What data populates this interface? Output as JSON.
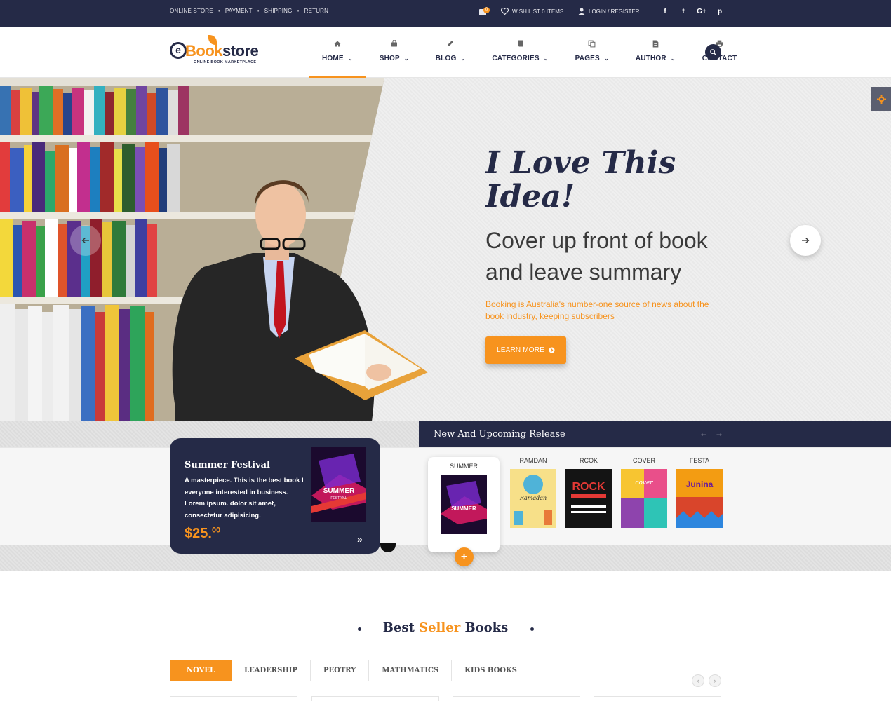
{
  "topbar": {
    "links": [
      "ONLINE STORE",
      "PAYMENT",
      "SHIPPING",
      "RETURN"
    ],
    "cart_count": "0",
    "wishlist": "WISH LIST 0 ITEMS",
    "login": "LOGIN / REGISTER",
    "social": [
      {
        "icon": "facebook-icon",
        "glyph": "f"
      },
      {
        "icon": "twitter-icon",
        "glyph": "t"
      },
      {
        "icon": "google-plus-icon",
        "glyph": "G+"
      },
      {
        "icon": "pinterest-icon",
        "glyph": "p"
      }
    ]
  },
  "logo": {
    "e": "e",
    "book": "Book",
    "store": "store",
    "tagline": "ONLINE BOOK MARKETPLACE"
  },
  "nav": [
    {
      "label": "HOME",
      "icon": "home-icon",
      "dropdown": true,
      "active": true
    },
    {
      "label": "SHOP",
      "icon": "shopping-bag-icon",
      "dropdown": true
    },
    {
      "label": "BLOG",
      "icon": "pencil-icon",
      "dropdown": true
    },
    {
      "label": "CATEGORIES",
      "icon": "book-icon",
      "dropdown": true
    },
    {
      "label": "PAGES",
      "icon": "copy-icon",
      "dropdown": true
    },
    {
      "label": "AUTHOR",
      "icon": "document-icon",
      "dropdown": true
    },
    {
      "label": "CONTACT",
      "icon": "printer-icon",
      "dropdown": false
    }
  ],
  "hero": {
    "title": "I Love This Idea!",
    "subtitle": "Cover up front of book and leave summary",
    "text": "Booking is Australia's number-one source of news about the book industry, keeping subscribers",
    "button": "LEARN MORE"
  },
  "release": {
    "heading": "New And Upcoming Release",
    "featured": {
      "title": "Summer Festival",
      "description": "A masterpiece. This is the best book I everyone interested in business. Lorem ipsum. dolor sit amet, consectetur adipisicing.",
      "price": "$25.",
      "cents": "00",
      "cover_title": "SUMMER",
      "cover_sub": "FESTIVAL"
    },
    "items": [
      {
        "label": "SUMMER",
        "cover_text": "SUMMER"
      },
      {
        "label": "RAMDAN",
        "cover_text": "Ramadan"
      },
      {
        "label": "RCOK",
        "cover_text": "ROCK"
      },
      {
        "label": "COVER",
        "cover_text": "cover"
      },
      {
        "label": "FESTA",
        "cover_text": "Junina"
      }
    ]
  },
  "best_seller": {
    "title_pre": "Best",
    "title_hl": "Seller",
    "title_post": "Books",
    "tabs": [
      "NOVEL",
      "LEADERSHIP",
      "PEOTRY",
      "MATHMATICS",
      "KIDS BOOKS"
    ]
  },
  "colors": {
    "navy": "#252a47",
    "orange": "#f7931e"
  }
}
